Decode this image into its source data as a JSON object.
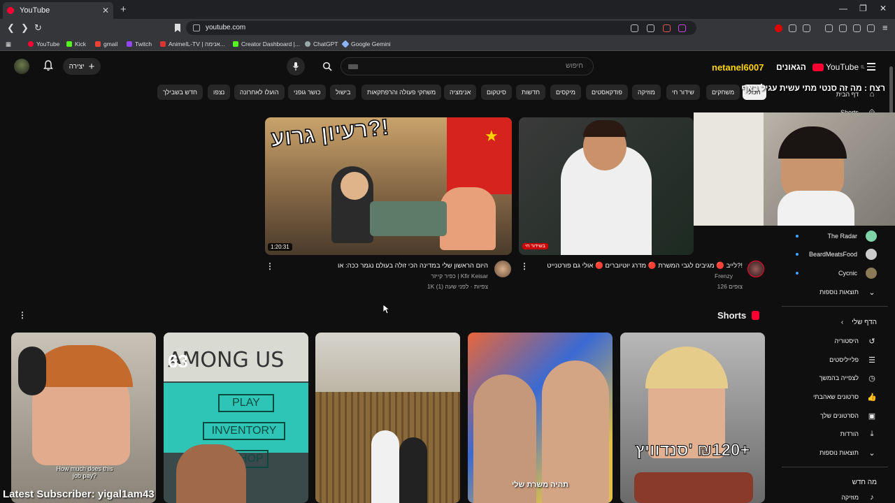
{
  "browser": {
    "tab_title": "YouTube",
    "url": "youtube.com",
    "bookmarks": [
      "YouTube",
      "Kick",
      "gmail",
      "Twitch",
      "AnimeIL-TV | אנימה...",
      "Creator Dashboard |...",
      "ChatGPT",
      "Google Gemini"
    ]
  },
  "header": {
    "create_label": "יצירה",
    "search_placeholder": "חיפוש",
    "logo_text": "YouTube",
    "logo_suffix": "IL"
  },
  "chips": [
    "הכול",
    "משחקים",
    "שידור חי",
    "מוזיקה",
    "פודקאסטים",
    "מיקסים",
    "חדשות",
    "סיטקום",
    "אנימציה",
    "משחקי פעולה והרפתקאות",
    "בישול",
    "כושר גופני",
    "הועלו לאחרונה",
    "נצפו",
    "חדש בשבילך"
  ],
  "sidebar": {
    "top_items": [
      "דף הבית",
      "Shorts"
    ],
    "subscriptions": [
      "The Radar",
      "BeardMeatsFood",
      "Cycnic"
    ],
    "show_more_1": "תוצאות נוספות",
    "you_header": "הדף שלי",
    "you_items": [
      "היסטוריה",
      "פלייליסטים",
      "לצפייה בהמשך",
      "סרטונים שאהבתי",
      "הסרטונים שלך",
      "הורדות"
    ],
    "show_more_2": "תוצאות נוספות",
    "explore_header": "מה חדש",
    "explore_items": [
      "מוזיקה"
    ]
  },
  "videos": [
    {
      "title": "היום הראשון שלי במדינה הכי זולה בעולם נגמר ככה: או",
      "channel": "כפיר קייזר | Kfir Keisar",
      "meta": "1K צפיות · לפני שעה (1)",
      "duration": "1:20:31",
      "thumb_text": "רעיון גרוע?!"
    },
    {
      "title": "לייב 🔴 מגיבים לגבי המשרת 🔴 מדרג יוטיוברים 🔴 אולי גם פורטנייט?!",
      "channel": "Frenzy",
      "meta": "126 צופים",
      "live_badge": "בשידור חי"
    }
  ],
  "shorts": {
    "header": "Shorts",
    "items": [
      {
        "caption": "How much does this job pay?"
      },
      {
        "caption": "AMONG US",
        "menu": [
          "PLAY",
          "INVENTORY",
          "SHOP"
        ],
        "number": "63"
      },
      {
        "caption": ""
      },
      {
        "caption": "תהיה משרת שלי"
      },
      {
        "caption": "סנדוויץ' ‎₪120+"
      }
    ]
  },
  "overlay": {
    "top_user": "netanel6007",
    "top_text": "הגאונים",
    "title": "מה זה סנטי מתי עשית עגיל באף",
    "title_prefix": "רצח : ",
    "latest_subscriber": "Latest Subscriber: yigal1am43"
  }
}
